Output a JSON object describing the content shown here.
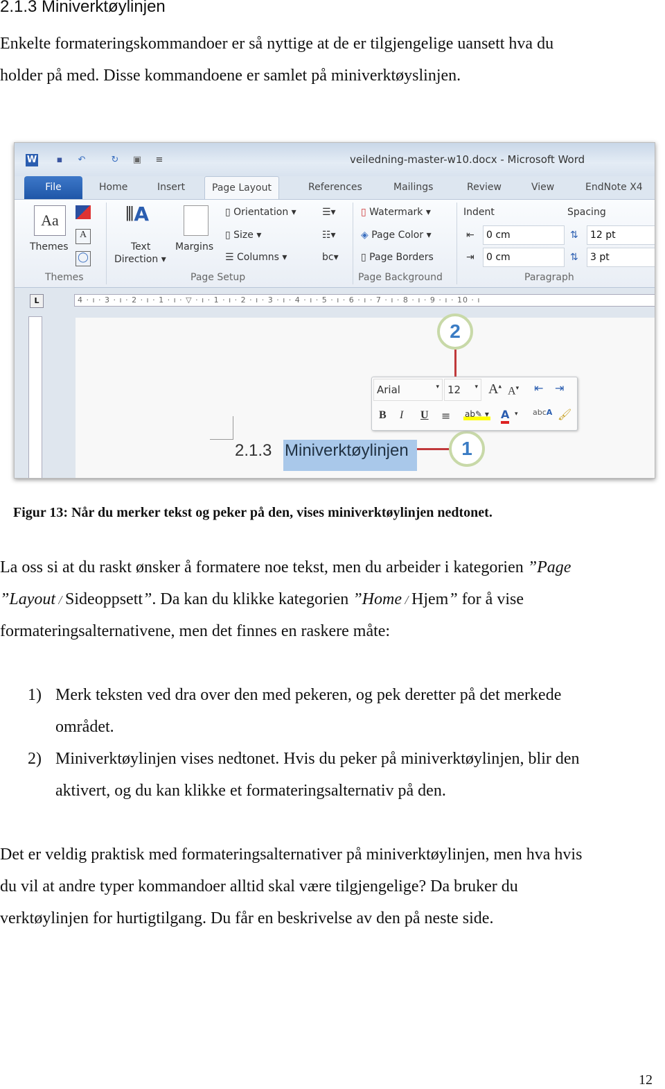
{
  "heading": "2.1.3  Miniverktøylinjen",
  "intro": [
    "Enkelte formateringskommandoer er så nyttige at de er tilgjengelige uansett hva du",
    "holder på med. Disse kommandoene er samlet på miniverktøyslinjen."
  ],
  "figure": {
    "window_title": "veiledning-master-w10.docx  -  Microsoft Word",
    "tabs": [
      "File",
      "Home",
      "Insert",
      "Page Layout",
      "References",
      "Mailings",
      "Review",
      "View",
      "EndNote X4"
    ],
    "active_tab": "Page Layout",
    "ribbon": {
      "themes": "Themes",
      "text_direction": [
        "Text",
        "Direction ▾"
      ],
      "margins": "Margins",
      "orientation": "Orientation ▾",
      "size": "Size ▾",
      "columns": "Columns ▾",
      "watermark": "Watermark ▾",
      "page_color": "Page Color ▾",
      "page_borders": "Page Borders",
      "indent": "Indent",
      "spacing": "Spacing",
      "indent_left": "0 cm",
      "indent_right": "0 cm",
      "spacing_before": "12 pt",
      "spacing_after": "3 pt",
      "groups": [
        "Themes",
        "Page Setup",
        "Page Background",
        "Paragraph"
      ]
    },
    "ruler": "4 · ı · 3 · ı · 2 · ı · 1 · ı · ▽ · ı · 1 · ı · 2 · ı · 3 · ı · 4 · ı · 5 · ı · 6 · ı · 7 · ı · 8 · ı · 9 · ı · 10 · ı",
    "mini_toolbar": {
      "font": "Arial",
      "size": "12"
    },
    "doc_number": "2.1.3",
    "doc_heading": "Miniverktøylinjen",
    "callouts": [
      "1",
      "2"
    ],
    "accent": "#3b7cc4",
    "line_color": "#c0393b"
  },
  "caption": "Figur 13: Når du merker tekst og peker på den, vises miniverktøylinjen nedtonet.",
  "para1": {
    "a": "La oss si at du raskt ønsker å formatere noe tekst, men du arbeider i kategorien ",
    "b": "”Page",
    "c": "”Layout",
    "d": " / ",
    "e": "Sideoppsett",
    "f": "”",
    "g": ". Da kan du klikke kategorien ",
    "h": "”Home",
    "i": " / ",
    "j": "Hjem",
    "k": "”",
    "l": " for å vise",
    "m": "formateringsalternativene, men det finnes en raskere måte:"
  },
  "list": [
    {
      "n": "1)",
      "lines": [
        "Merk teksten ved dra over den med pekeren, og pek deretter på det merkede",
        "området."
      ]
    },
    {
      "n": "2)",
      "lines": [
        "Miniverktøylinjen vises nedtonet. Hvis du peker på miniverktøylinjen, blir den",
        "aktivert, og du kan klikke et formateringsalternativ på den."
      ]
    }
  ],
  "para2": [
    "Det er veldig praktisk med formateringsalternativer på miniverktøylinjen, men hva hvis",
    "du vil at andre typer kommandoer alltid skal være tilgjengelige? Da bruker du",
    "verktøylinjen for hurtigtilgang. Du får en beskrivelse av den på neste side."
  ],
  "page_number": "12"
}
